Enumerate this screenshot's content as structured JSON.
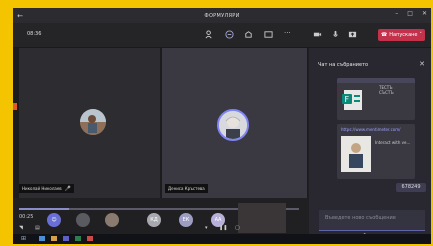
{
  "window": {
    "title": "ФОРМУЛЯРИ"
  },
  "toolbar": {
    "timer": "08:36",
    "leave_label": "Напускане"
  },
  "participants": [
    {
      "name": "Николай Николаев"
    },
    {
      "name": "Дениса Кръстева"
    }
  ],
  "chat": {
    "title": "Чат на събранието",
    "card1": {
      "line1": "ТЕСТЪ",
      "line2": "СЪСТЪ"
    },
    "card2": {
      "url": "https://www.mentimeter.com/",
      "text": "Interact with ve..."
    },
    "badge": "678249",
    "compose_placeholder": "Въведете ново съобщение"
  },
  "bottom": {
    "time": "00:25",
    "progress": 0.18,
    "avatars": [
      "КД",
      "ЕК",
      "АА"
    ]
  },
  "colors": {
    "accent": "#6264a7",
    "leave": "#c4314b",
    "frame": "#f5c400"
  }
}
